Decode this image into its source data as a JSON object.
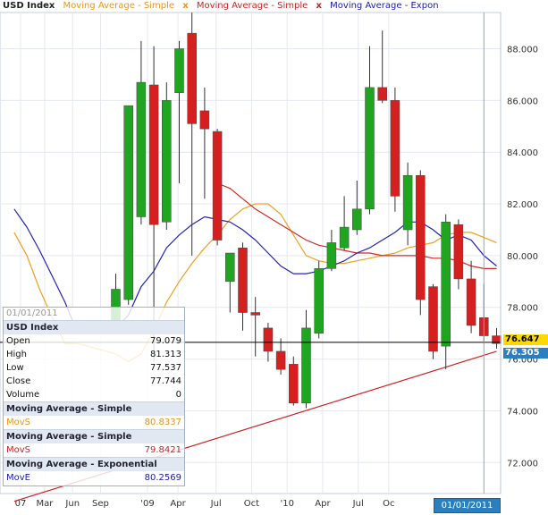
{
  "legend": {
    "title": "USD Index",
    "items": [
      {
        "label": "Moving Average - Simple",
        "color": "#e8951d"
      },
      {
        "label": "Moving Average - Simple",
        "color": "#cc2222"
      },
      {
        "label": "Moving Average - Expon",
        "color": "#1a1aa8"
      }
    ],
    "separator": "x"
  },
  "colors": {
    "up": "#1fa51f",
    "down": "#d62020",
    "sma1": "#f0a020",
    "sma2": "#d22a22",
    "ema": "#2323b8",
    "trend": "#cc2222",
    "grid": "#e4e8f0"
  },
  "chart_data": {
    "type": "candlestick",
    "title": "USD Index",
    "ylim": [
      70.8,
      89.4
    ],
    "y_ticks": [
      "88.000",
      "86.000",
      "84.000",
      "82.000",
      "80.000",
      "78.000",
      "76.000",
      "74.000",
      "72.000"
    ],
    "y_tick_values": [
      88,
      86,
      84,
      82,
      80,
      78,
      76,
      74,
      72
    ],
    "x_labels": [
      "07",
      "Mar",
      "Jun",
      "Sep",
      "'09",
      "Apr",
      "Jul",
      "Oct",
      "'10",
      "Apr",
      "Jul",
      "Oc"
    ],
    "x_label_index": [
      -7.5,
      -5.6,
      -3.4,
      -1.2,
      2.5,
      4.9,
      7.9,
      10.7,
      13.5,
      16.3,
      19.1,
      21.5
    ],
    "candles": [
      {
        "o": 77.5,
        "h": 79.3,
        "l": 77.0,
        "c": 78.7
      },
      {
        "o": 78.3,
        "h": 84.0,
        "l": 78.1,
        "c": 85.8
      },
      {
        "o": 81.5,
        "h": 88.3,
        "l": 81.2,
        "c": 86.7
      },
      {
        "o": 86.6,
        "h": 88.1,
        "l": 75.9,
        "c": 81.2
      },
      {
        "o": 81.3,
        "h": 86.7,
        "l": 81.0,
        "c": 86.0
      },
      {
        "o": 86.3,
        "h": 88.3,
        "l": 82.8,
        "c": 88.0
      },
      {
        "o": 88.6,
        "h": 89.4,
        "l": 80.0,
        "c": 85.1
      },
      {
        "o": 85.6,
        "h": 86.5,
        "l": 82.2,
        "c": 84.9
      },
      {
        "o": 84.8,
        "h": 84.9,
        "l": 80.4,
        "c": 80.6
      },
      {
        "o": 79.0,
        "h": 80.1,
        "l": 77.8,
        "c": 80.1
      },
      {
        "o": 80.3,
        "h": 80.5,
        "l": 77.1,
        "c": 77.8
      },
      {
        "o": 77.8,
        "h": 78.4,
        "l": 76.1,
        "c": 77.7
      },
      {
        "o": 77.2,
        "h": 77.4,
        "l": 75.9,
        "c": 76.3
      },
      {
        "o": 76.3,
        "h": 76.8,
        "l": 75.4,
        "c": 75.6
      },
      {
        "o": 75.8,
        "h": 76.1,
        "l": 74.2,
        "c": 74.3
      },
      {
        "o": 74.3,
        "h": 77.9,
        "l": 74.1,
        "c": 77.2
      },
      {
        "o": 77.0,
        "h": 79.8,
        "l": 76.8,
        "c": 79.5
      },
      {
        "o": 79.5,
        "h": 81.0,
        "l": 79.4,
        "c": 80.5
      },
      {
        "o": 80.3,
        "h": 82.3,
        "l": 80.2,
        "c": 81.1
      },
      {
        "o": 81.0,
        "h": 82.9,
        "l": 80.8,
        "c": 81.8
      },
      {
        "o": 81.8,
        "h": 88.1,
        "l": 81.6,
        "c": 86.5
      },
      {
        "o": 86.5,
        "h": 88.7,
        "l": 85.9,
        "c": 86.0
      },
      {
        "o": 86.0,
        "h": 86.5,
        "l": 81.7,
        "c": 82.3
      },
      {
        "o": 81.0,
        "h": 83.6,
        "l": 80.4,
        "c": 83.1
      },
      {
        "o": 83.1,
        "h": 83.3,
        "l": 77.7,
        "c": 78.3
      },
      {
        "o": 78.8,
        "h": 78.9,
        "l": 76.0,
        "c": 76.3
      },
      {
        "o": 76.5,
        "h": 81.6,
        "l": 75.6,
        "c": 81.3
      },
      {
        "o": 81.2,
        "h": 81.4,
        "l": 78.7,
        "c": 79.1
      },
      {
        "o": 79.1,
        "h": 79.8,
        "l": 77.0,
        "c": 77.3
      },
      {
        "o": 77.6,
        "h": 78.9,
        "l": 76.6,
        "c": 76.9
      },
      {
        "o": 76.9,
        "h": 77.2,
        "l": 76.4,
        "c": 76.6
      }
    ],
    "sma1": [
      [
        -8,
        80.9
      ],
      [
        -7,
        80.0
      ],
      [
        -6,
        78.7
      ],
      [
        -5,
        77.6
      ],
      [
        -4,
        76.6
      ],
      [
        -3,
        76.6
      ],
      [
        0,
        76.2
      ],
      [
        1,
        75.9
      ],
      [
        2,
        76.2
      ],
      [
        3,
        77.1
      ],
      [
        4,
        78.2
      ],
      [
        5,
        79.0
      ],
      [
        6,
        79.7
      ],
      [
        7,
        80.3
      ],
      [
        8,
        80.8
      ],
      [
        9,
        81.4
      ],
      [
        10,
        81.8
      ],
      [
        11,
        82.0
      ],
      [
        12,
        82.0
      ],
      [
        13,
        81.6
      ],
      [
        14,
        80.8
      ],
      [
        15,
        80.0
      ],
      [
        16,
        79.8
      ],
      [
        17,
        79.7
      ],
      [
        18,
        79.7
      ],
      [
        19,
        79.8
      ],
      [
        20,
        79.9
      ],
      [
        21,
        80.0
      ],
      [
        22,
        80.1
      ],
      [
        23,
        80.3
      ],
      [
        24,
        80.4
      ],
      [
        25,
        80.5
      ],
      [
        26,
        80.8
      ],
      [
        27,
        80.9
      ],
      [
        28,
        80.9
      ],
      [
        29,
        80.7
      ],
      [
        30,
        80.5
      ]
    ],
    "sma2": [
      [
        8,
        82.8
      ],
      [
        9,
        82.6
      ],
      [
        10,
        82.2
      ],
      [
        11,
        81.8
      ],
      [
        12,
        81.5
      ],
      [
        13,
        81.2
      ],
      [
        14,
        80.9
      ],
      [
        15,
        80.6
      ],
      [
        16,
        80.4
      ],
      [
        17,
        80.3
      ],
      [
        18,
        80.2
      ],
      [
        19,
        80.1
      ],
      [
        20,
        80.1
      ],
      [
        21,
        80.0
      ],
      [
        22,
        80.0
      ],
      [
        23,
        80.0
      ],
      [
        24,
        80.0
      ],
      [
        25,
        79.9
      ],
      [
        26,
        79.9
      ],
      [
        27,
        79.8
      ],
      [
        28,
        79.6
      ],
      [
        29,
        79.5
      ],
      [
        30,
        79.5
      ]
    ],
    "ema": [
      [
        -8,
        81.8
      ],
      [
        -7,
        81.1
      ],
      [
        -6,
        80.2
      ],
      [
        -5,
        79.2
      ],
      [
        -4,
        78.2
      ],
      [
        -3,
        77.0
      ],
      [
        0,
        77.2
      ],
      [
        1,
        77.7
      ],
      [
        2,
        78.8
      ],
      [
        3,
        79.4
      ],
      [
        4,
        80.3
      ],
      [
        5,
        80.8
      ],
      [
        6,
        81.2
      ],
      [
        7,
        81.5
      ],
      [
        8,
        81.4
      ],
      [
        9,
        81.3
      ],
      [
        10,
        81.0
      ],
      [
        11,
        80.6
      ],
      [
        12,
        80.1
      ],
      [
        13,
        79.6
      ],
      [
        14,
        79.3
      ],
      [
        15,
        79.3
      ],
      [
        16,
        79.4
      ],
      [
        17,
        79.6
      ],
      [
        18,
        79.8
      ],
      [
        19,
        80.1
      ],
      [
        20,
        80.3
      ],
      [
        21,
        80.6
      ],
      [
        22,
        80.9
      ],
      [
        23,
        81.3
      ],
      [
        24,
        81.3
      ],
      [
        25,
        81.0
      ],
      [
        26,
        80.6
      ],
      [
        27,
        80.8
      ],
      [
        28,
        80.6
      ],
      [
        29,
        80.0
      ],
      [
        30,
        79.6
      ]
    ],
    "trendline": [
      [
        -8,
        70.5
      ],
      [
        30,
        76.3
      ]
    ],
    "crosshair": {
      "x_index": 29.0,
      "y_value": 76.647
    }
  },
  "price_labels": {
    "current": {
      "text": "76.647",
      "value": 76.647
    },
    "trend": {
      "text": "76.305",
      "value": 76.305
    }
  },
  "date_badge": "01/01/2011",
  "panel": {
    "date": "01/01/2011",
    "section_main": "USD Index",
    "rows": [
      {
        "label": "Open",
        "value": "79.079"
      },
      {
        "label": "High",
        "value": "81.313"
      },
      {
        "label": "Low",
        "value": "77.537"
      },
      {
        "label": "Close",
        "value": "77.744"
      },
      {
        "label": "Volume",
        "value": "0"
      }
    ],
    "sma1_head": "Moving Average - Simple",
    "sma1": {
      "label": "MovS",
      "value": "80.8337"
    },
    "sma2_head": "Moving Average - Simple",
    "sma2": {
      "label": "MovS",
      "value": "79.8421"
    },
    "ema_head": "Moving Average - Exponential",
    "ema": {
      "label": "MovE",
      "value": "80.2569"
    }
  }
}
